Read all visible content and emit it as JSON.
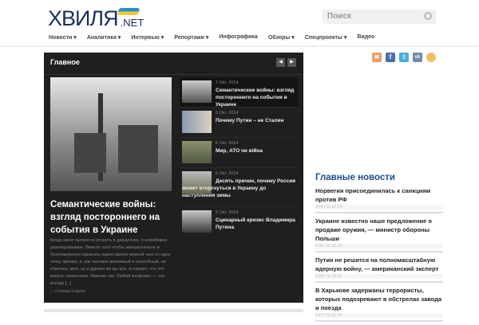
{
  "header": {
    "logo_main": "ХВИЛЯ",
    "logo_net": ".NET",
    "search_placeholder": "Поиск",
    "nav": [
      "Новости ▾",
      "Аналитика ▾",
      "Интервью ▾",
      "Репортажи ▾",
      "Инфографика",
      "Обзоры ▾",
      "Спецпроекты ▾",
      "Видео"
    ]
  },
  "social": [
    "rss-icon",
    "facebook-icon",
    "twitter-icon",
    "vk-icon",
    "chat-icon"
  ],
  "featured": {
    "title": "Главное",
    "prev": "◀",
    "next": "▶",
    "main": {
      "title": "Семантические войны: взгляд постороннего на события в Украине",
      "excerpt": "Когда меня пытаются втянуть в дискуссию, я неизбежно разочаровываю. Вместо того чтобы эмоционально и безоговорочно признать единственно верной чью-то одну точку зрения, я, как человек вежливый и незлобный, не отвечаю, мол, ну и дураки же вы все, а говорю, что это вопрос семантики. Именно так. Любой конфликт — это всегда [...]",
      "comments": "▭ 0 комментариев"
    },
    "items": [
      {
        "date": "7 Окт. 2014",
        "title": "Семантические войны: взгляд постороннего на события в Украине"
      },
      {
        "date": "6 Окт. 2014",
        "title": "Почему Путин – не Сталин"
      },
      {
        "date": "6 Окт. 2014",
        "title": "Мир, АТО чи війна"
      },
      {
        "date": "6 Окт. 2014",
        "title": "Десять причин, почему Россия может вторгнуться в Украину до наступления зимы"
      },
      {
        "date": "5 Окт. 2014",
        "title": "Сценарный кризис Владимира Путина"
      }
    ]
  },
  "sidebar": {
    "heading": "Главные новости",
    "news": [
      {
        "title": "Норвегия присоединилась к санкциям против РФ",
        "time": "3:00 / 11.10.14"
      },
      {
        "title": "Украине известно наше предложение о продаже оружия, — министр обороны Польши",
        "time": "2:00 / 11.10.14"
      },
      {
        "title": "Путин не решится на полномасштабную ядерную войну, — американский эксперт",
        "time": "1:20 / 11.10.14"
      },
      {
        "title": "В Харькове задержаны террористы, которых подозревают в обстрелах завода и поезда",
        "time": "0:17 / 11.10.14"
      }
    ]
  }
}
